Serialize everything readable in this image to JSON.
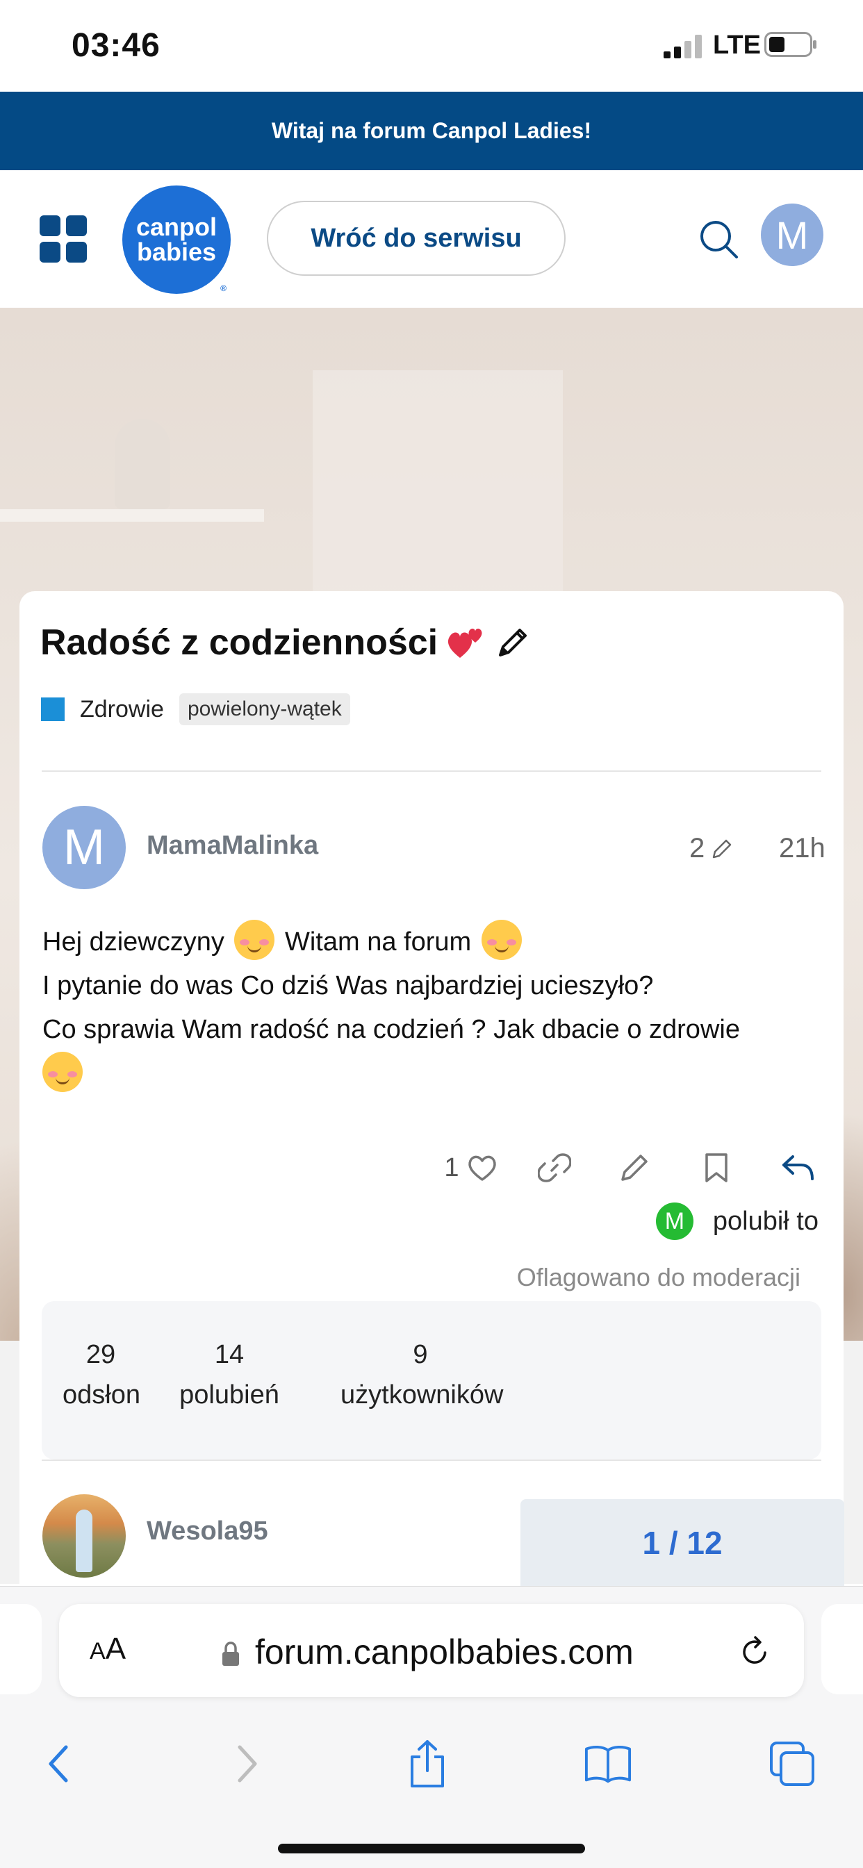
{
  "status_bar": {
    "time": "03:46",
    "network": "LTE"
  },
  "banner": {
    "text": "Witaj na forum Canpol Ladies!"
  },
  "header": {
    "logo_line1": "canpol",
    "logo_line2": "babies",
    "logo_reg": "®",
    "back_button": "Wróć do serwisu",
    "avatar_letter": "M"
  },
  "topic": {
    "title": "Radość z codzienności",
    "category": "Zdrowie",
    "category_color": "#1b8fd7",
    "tag": "powielony-wątek"
  },
  "post": {
    "avatar_letter": "M",
    "username": "MamaMalinka",
    "edits": "2",
    "time": "21h",
    "line1_a": "Hej dziewczyny",
    "line1_b": "Witam na forum",
    "line2": "I pytanie do was Co dziś Was najbardziej ucieszyło?",
    "line3": "Co sprawia Wam radość na codzień ? Jak dbacie o zdrowie",
    "like_count": "1",
    "liked_by_letter": "M",
    "liked_text": "polubił to",
    "flagged": "Oflagowano do moderacji"
  },
  "stats": [
    {
      "number": "29",
      "label": "odsłon"
    },
    {
      "number": "14",
      "label": "polubień"
    },
    {
      "number": "9",
      "label": "użytkowników"
    }
  ],
  "next_post": {
    "username": "Wesola95"
  },
  "progress": {
    "text": "1 / 12"
  },
  "browser": {
    "aa_label_big": "A",
    "aa_label_small": "A",
    "url": "forum.canpolbabies.com"
  },
  "colors": {
    "banner_bg": "#044a85",
    "brand_blue": "#1d6fd6",
    "avatar_bg": "#8fadde",
    "like_avatar_bg": "#25bb33",
    "progress_text": "#2d6bd0"
  }
}
